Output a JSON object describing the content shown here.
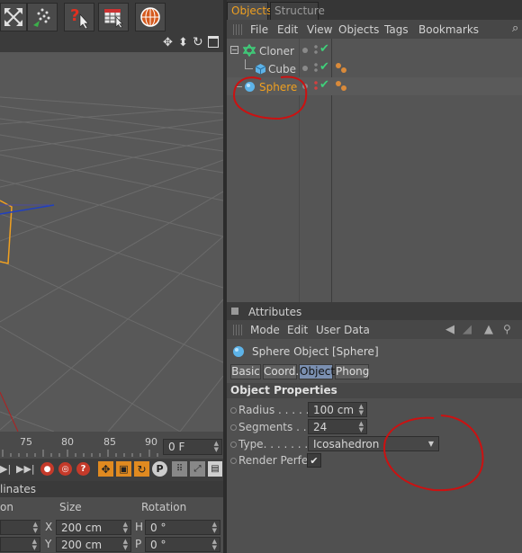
{
  "objects_tab": "Objects",
  "structure_tab": "Structure",
  "objects_menu": [
    "File",
    "Edit",
    "View",
    "Objects",
    "Tags",
    "Bookmarks"
  ],
  "tree": {
    "cloner": "Cloner",
    "cube": "Cube",
    "sphere": "Sphere"
  },
  "attributes": {
    "title": "Attributes",
    "menu": [
      "Mode",
      "Edit",
      "User Data"
    ],
    "object_title": "Sphere Object [Sphere]",
    "tabs": [
      "Basic",
      "Coord.",
      "Object",
      "Phong"
    ],
    "section": "Object Properties",
    "radius_label": "Radius . . . . . .",
    "radius_value": "100 cm",
    "segments_label": "Segments . . . .",
    "segments_value": "24",
    "type_label": "Type. . . . . . . .",
    "type_value": "Icosahedron",
    "render_label": "Render Perfect",
    "render_check": "✔"
  },
  "timeline": {
    "ticks": [
      "75",
      "80",
      "85",
      "90"
    ],
    "frame": "0 F"
  },
  "coords": {
    "header_left": "linates",
    "cols": [
      "on",
      "Size",
      "Rotation"
    ],
    "row1": {
      "x_label": "X",
      "size": "200 cm",
      "r_label": "H",
      "rot": "0 °"
    },
    "row2": {
      "y_label": "Y",
      "size": "200 cm",
      "r_label": "P",
      "rot": "0 °"
    }
  },
  "colors": {
    "accent": "#f0a020",
    "annotation": "#cc1111",
    "active_tab": "#7a8fb0"
  }
}
